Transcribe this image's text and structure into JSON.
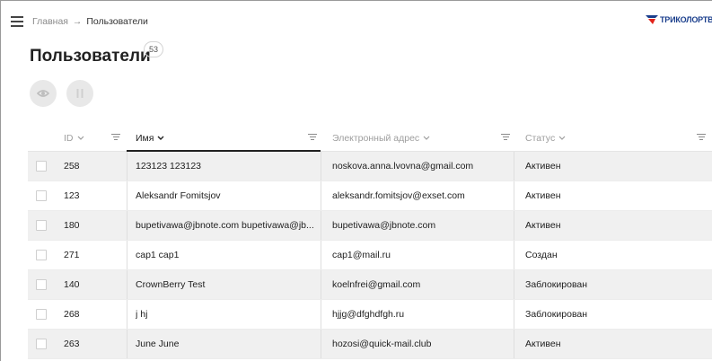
{
  "breadcrumb": {
    "home": "Главная",
    "separator": "→",
    "current": "Пользователи"
  },
  "logo": {
    "text": "ТРИКОЛОРТВ"
  },
  "page": {
    "title": "Пользователи",
    "count": "53"
  },
  "colors": {
    "logo_blue": "#1a3e8c",
    "logo_red": "#e2231a",
    "row_shade": "#f0f0f0"
  },
  "actions": [
    {
      "name": "view",
      "icon": "eye-icon"
    },
    {
      "name": "pause",
      "icon": "pause-icon"
    }
  ],
  "table": {
    "columns": [
      {
        "key": "id",
        "label": "ID",
        "sort_icon": "chevron-down-icon",
        "active": false
      },
      {
        "key": "name",
        "label": "Имя",
        "sort_icon": "chevron-down-icon",
        "active": true
      },
      {
        "key": "email",
        "label": "Электронный адрес",
        "sort_icon": "chevron-down-icon",
        "active": false
      },
      {
        "key": "status",
        "label": "Статус",
        "sort_icon": "chevron-down-icon",
        "active": false
      }
    ],
    "rows": [
      {
        "id": "258",
        "name": "123123 123123",
        "email": "noskova.anna.lvovna@gmail.com",
        "status": "Активен"
      },
      {
        "id": "123",
        "name": "Aleksandr Fomitsjov",
        "email": "aleksandr.fomitsjov@exset.com",
        "status": "Активен"
      },
      {
        "id": "180",
        "name": "bupetivawa@jbnote.com bupetivawa@jb...",
        "email": "bupetivawa@jbnote.com",
        "status": "Активен"
      },
      {
        "id": "271",
        "name": "cap1 cap1",
        "email": "cap1@mail.ru",
        "status": "Создан"
      },
      {
        "id": "140",
        "name": "CrownBerry Test",
        "email": "koelnfrei@gmail.com",
        "status": "Заблокирован"
      },
      {
        "id": "268",
        "name": "j hj",
        "email": "hjjg@dfghdfgh.ru",
        "status": "Заблокирован"
      },
      {
        "id": "263",
        "name": "June June",
        "email": "hozosi@quick-mail.club",
        "status": "Активен"
      }
    ]
  }
}
